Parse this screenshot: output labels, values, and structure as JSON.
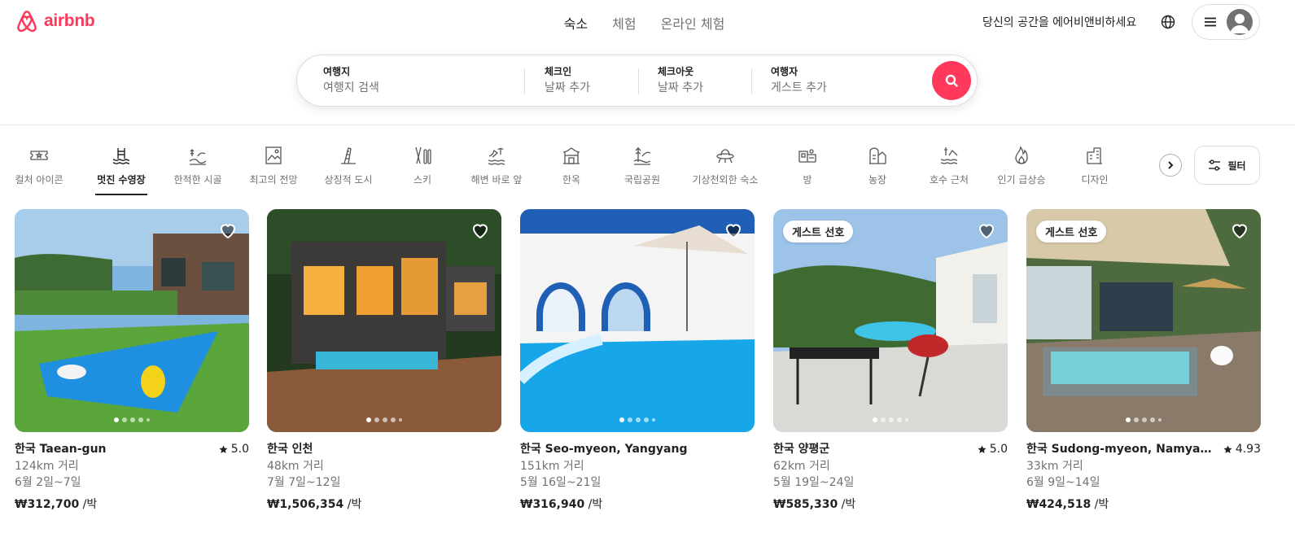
{
  "brand": {
    "name": "airbnb",
    "color": "#ff385c"
  },
  "nav": {
    "tabs": [
      "숙소",
      "체험",
      "온라인 체험"
    ],
    "active": 0
  },
  "header": {
    "host_link": "당신의 공간을 에어비앤비하세요",
    "globe_icon": "globe-icon",
    "menu_icon": "menu-icon"
  },
  "search": {
    "destination": {
      "label": "여행지",
      "placeholder": "여행지 검색"
    },
    "checkin": {
      "label": "체크인",
      "placeholder": "날짜 추가"
    },
    "checkout": {
      "label": "체크아웃",
      "placeholder": "날짜 추가"
    },
    "guests": {
      "label": "여행자",
      "placeholder": "게스트 추가"
    },
    "button_icon": "search-icon"
  },
  "categories": [
    {
      "label": "컬처 아이콘",
      "icon": "ticket-icon"
    },
    {
      "label": "멋진 수영장",
      "icon": "pool-icon",
      "active": true
    },
    {
      "label": "한적한 시골",
      "icon": "countryside-icon"
    },
    {
      "label": "최고의 전망",
      "icon": "view-icon"
    },
    {
      "label": "상징적 도시",
      "icon": "city-icon"
    },
    {
      "label": "스키",
      "icon": "ski-icon"
    },
    {
      "label": "해변 바로 앞",
      "icon": "beach-icon"
    },
    {
      "label": "한옥",
      "icon": "hanok-icon"
    },
    {
      "label": "국립공원",
      "icon": "park-icon"
    },
    {
      "label": "기상천외한 숙소",
      "icon": "ufo-icon"
    },
    {
      "label": "방",
      "icon": "room-icon"
    },
    {
      "label": "농장",
      "icon": "farm-icon"
    },
    {
      "label": "호수 근처",
      "icon": "lake-icon"
    },
    {
      "label": "인기 급상승",
      "icon": "flame-icon"
    },
    {
      "label": "디자인",
      "icon": "design-icon"
    }
  ],
  "filter": {
    "label": "필터",
    "icon": "filter-icon"
  },
  "listings": [
    {
      "location": "한국 Taean-gun",
      "rating": "5.0",
      "distance": "124km 거리",
      "dates": "6월 2일~7일",
      "price": "₩312,700",
      "unit": " /박",
      "badge": ""
    },
    {
      "location": "한국 인천",
      "rating": "",
      "distance": "48km 거리",
      "dates": "7월 7일~12일",
      "price": "₩1,506,354",
      "unit": " /박",
      "badge": ""
    },
    {
      "location": "한국 Seo-myeon, Yangyang",
      "rating": "",
      "distance": "151km 거리",
      "dates": "5월 16일~21일",
      "price": "₩316,940",
      "unit": " /박",
      "badge": ""
    },
    {
      "location": "한국 양평군",
      "rating": "5.0",
      "distance": "62km 거리",
      "dates": "5월 19일~24일",
      "price": "₩585,330",
      "unit": " /박",
      "badge": "게스트 선호"
    },
    {
      "location": "한국 Sudong-myeon, Namyangj...",
      "rating": "4.93",
      "distance": "33km 거리",
      "dates": "6월 9일~14일",
      "price": "₩424,518",
      "unit": " /박",
      "badge": "게스트 선호"
    }
  ]
}
